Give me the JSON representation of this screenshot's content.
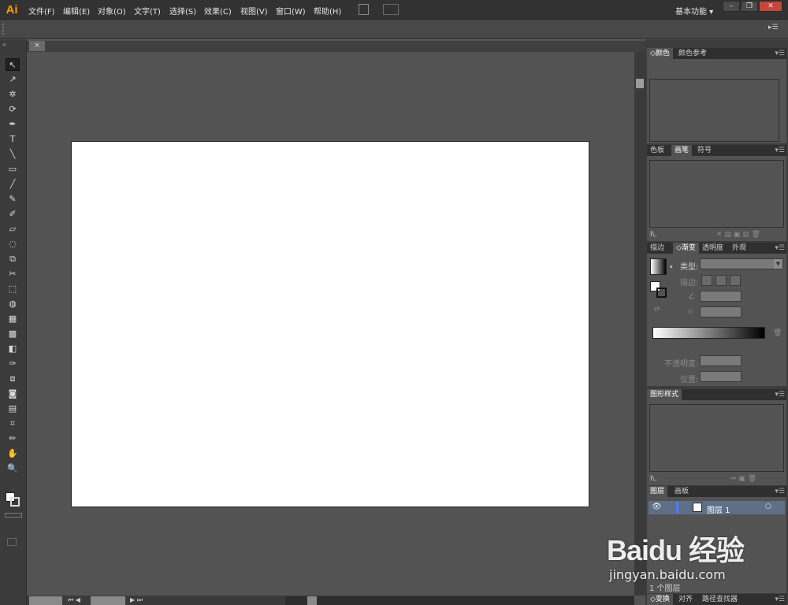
{
  "app": {
    "logo": "Ai",
    "workspace": "基本功能"
  },
  "menu": [
    "文件(F)",
    "编辑(E)",
    "对象(O)",
    "文字(T)",
    "选择(S)",
    "效果(C)",
    "视图(V)",
    "窗口(W)",
    "帮助(H)"
  ],
  "window_buttons": [
    "–",
    "❐",
    "✕"
  ],
  "document": {
    "tab_close": "×"
  },
  "tools": [
    "↖",
    "↗",
    "✲",
    "⟳",
    "✒",
    "T",
    "╲",
    "▭",
    "╱",
    "✎",
    "✐",
    "▱",
    "◌",
    "⧉",
    "✂",
    "⬚",
    "◍",
    "▦",
    "▩",
    "◧",
    "✑",
    "⧈",
    "◙",
    "▤",
    "⌗",
    "✏",
    "✋",
    "🔍"
  ],
  "panels": {
    "color": {
      "tabs": [
        "颜色",
        "颜色参考"
      ]
    },
    "brushes": {
      "tabs": [
        "色板",
        "画笔",
        "符号"
      ]
    },
    "gradient": {
      "tabs": [
        "描边",
        "渐变",
        "透明度",
        "外观"
      ],
      "type_label": "类型:",
      "stroke_label": "描边:",
      "opacity_label": "不透明度:",
      "position_label": "位置:"
    },
    "graphic_styles": {
      "tabs": [
        "图形样式"
      ]
    },
    "layers": {
      "tabs": [
        "图层",
        "画板"
      ],
      "layer_name": "图层 1",
      "count": "1 个图层"
    },
    "bottom": {
      "tabs": [
        "变换",
        "对齐",
        "路径查找器"
      ]
    }
  },
  "watermark": {
    "brand": "Baidu 经验",
    "url": "jingyan.baidu.com"
  }
}
